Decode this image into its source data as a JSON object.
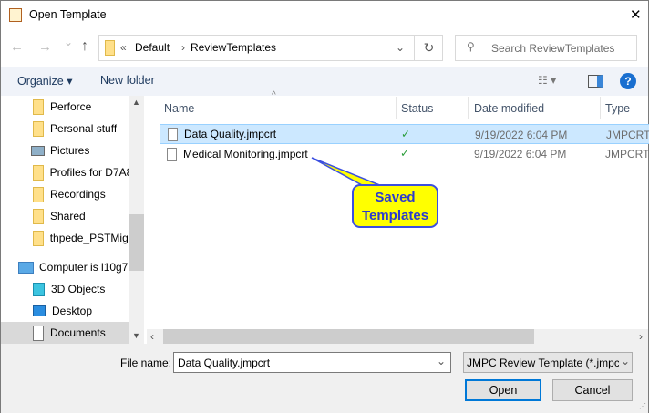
{
  "window": {
    "title": "Open Template",
    "close": "✕"
  },
  "nav": {
    "back": "←",
    "forward": "→",
    "recent": "⌄",
    "up": "↑"
  },
  "address": {
    "overflow": "«",
    "crumbs": [
      "Default",
      "ReviewTemplates"
    ],
    "sep": "›"
  },
  "search": {
    "placeholder": "Search ReviewTemplates"
  },
  "toolbar": {
    "organize": "Organize",
    "new_folder": "New folder",
    "help": "?"
  },
  "sidebar": {
    "items": [
      {
        "label": "Perforce",
        "icon": "folder"
      },
      {
        "label": "Personal stuff",
        "icon": "folder"
      },
      {
        "label": "Pictures",
        "icon": "pictures"
      },
      {
        "label": "Profiles for D7A8",
        "icon": "folder"
      },
      {
        "label": "Recordings",
        "icon": "folder"
      },
      {
        "label": "Shared",
        "icon": "folder"
      },
      {
        "label": "thpede_PSTMigr",
        "icon": "folder"
      },
      {
        "label": "Computer is l10g7",
        "icon": "computer"
      },
      {
        "label": "3D Objects",
        "icon": "3d"
      },
      {
        "label": "Desktop",
        "icon": "desktop"
      },
      {
        "label": "Documents",
        "icon": "documents"
      }
    ]
  },
  "columns": {
    "name": "Name",
    "status": "Status",
    "date": "Date modified",
    "type": "Type"
  },
  "files": [
    {
      "name": "Data Quality.jmpcrt",
      "status": "✓",
      "date": "9/19/2022 6:04 PM",
      "type": "JMPCRT F",
      "selected": true
    },
    {
      "name": "Medical Monitoring.jmpcrt",
      "status": "✓",
      "date": "9/19/2022 6:04 PM",
      "type": "JMPCRT F",
      "selected": false
    }
  ],
  "callout": {
    "line1": "Saved",
    "line2": "Templates"
  },
  "footer": {
    "filename_label": "File name:",
    "filename_value": "Data Quality.jmpcrt",
    "filter": "JMPC Review Template (*.jmpc",
    "open": "Open",
    "cancel": "Cancel"
  }
}
